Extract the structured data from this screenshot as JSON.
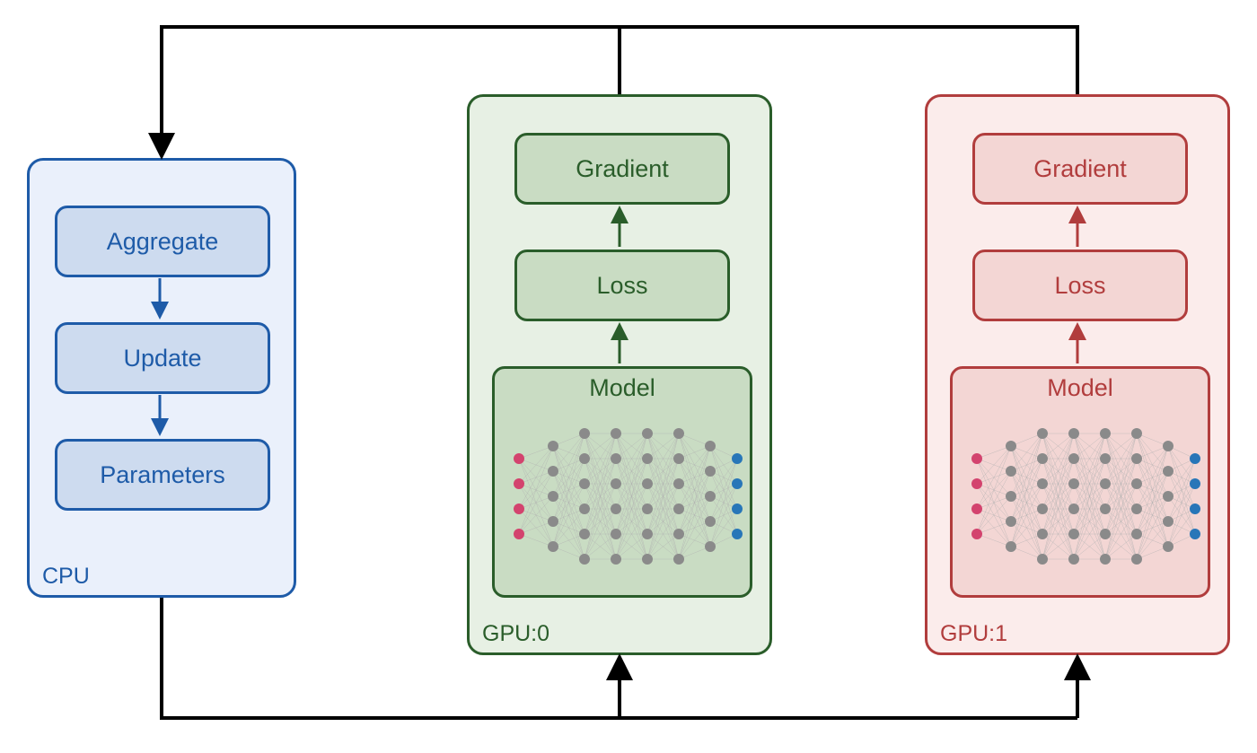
{
  "cpu": {
    "label": "CPU",
    "color": "#1e5ba8",
    "fill": "#eaf0fb",
    "block_fill": "#cddbef",
    "steps": [
      "Aggregate",
      "Update",
      "Parameters"
    ]
  },
  "gpus": [
    {
      "label": "GPU:0",
      "color": "#2a5d2a",
      "fill": "#e7f0e4",
      "block_fill": "#c9dcc3",
      "steps": [
        "Gradient",
        "Loss"
      ],
      "model_label": "Model"
    },
    {
      "label": "GPU:1",
      "color": "#b13d3d",
      "fill": "#fbeceb",
      "block_fill": "#f3d6d4",
      "steps": [
        "Gradient",
        "Loss"
      ],
      "model_label": "Model"
    }
  ],
  "nn": {
    "input_color": "#d3436e",
    "hidden_color": "#8a8a8a",
    "output_color": "#2876b8",
    "edge_color": "#b0b0b0"
  },
  "arrow_color": "#000000"
}
